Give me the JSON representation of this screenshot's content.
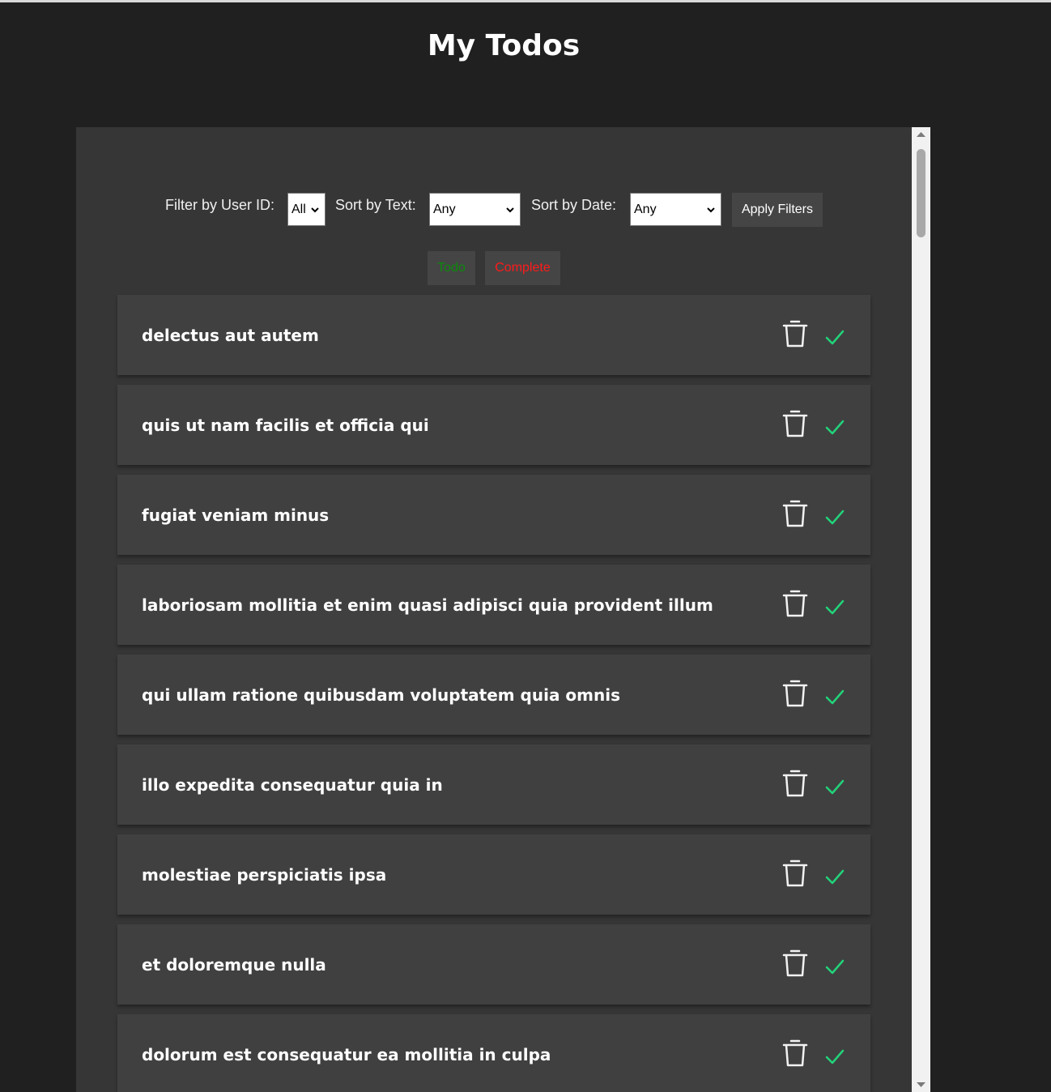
{
  "page": {
    "title": "My Todos"
  },
  "filters": {
    "user_id_label": "Filter by User ID:",
    "user_id_value": "All",
    "sort_text_label": "Sort by Text:",
    "sort_text_value": "Any",
    "sort_date_label": "Sort by Date:",
    "sort_date_value": "Any",
    "apply_label": "Apply Filters"
  },
  "status_buttons": {
    "todo_label": "Todo",
    "todo_color": "#0a8a0a",
    "complete_label": "Complete",
    "complete_color": "#ff1a1a"
  },
  "todos": [
    {
      "text": "delectus aut autem"
    },
    {
      "text": "quis ut nam facilis et officia qui"
    },
    {
      "text": "fugiat veniam minus"
    },
    {
      "text": "laboriosam mollitia et enim quasi adipisci quia provident illum"
    },
    {
      "text": "qui ullam ratione quibusdam voluptatem quia omnis"
    },
    {
      "text": "illo expedita consequatur quia in"
    },
    {
      "text": "molestiae perspiciatis ipsa"
    },
    {
      "text": "et doloremque nulla"
    },
    {
      "text": "dolorum est consequatur ea mollitia in culpa"
    }
  ],
  "icons": {
    "delete": "trash-icon",
    "complete": "check-icon",
    "dropdown": "chevron-down-icon"
  },
  "colors": {
    "background": "#202020",
    "panel": "#363636",
    "card": "#404040",
    "check": "#22d37a"
  }
}
